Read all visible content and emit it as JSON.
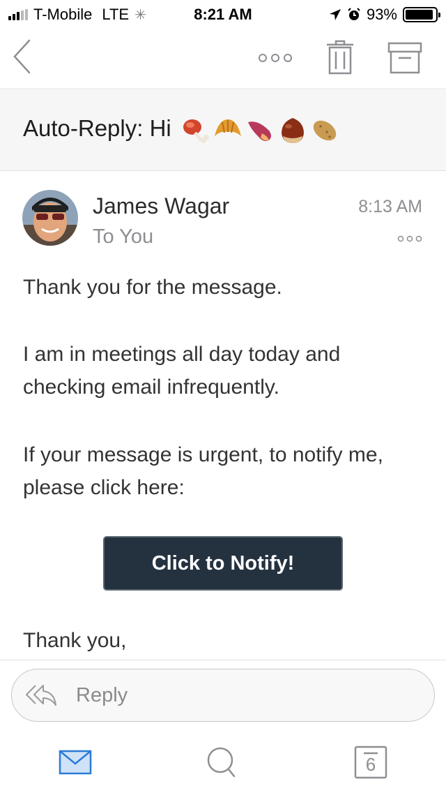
{
  "status_bar": {
    "carrier": "T-Mobile",
    "network": "LTE",
    "time": "8:21 AM",
    "battery_percent": "93%",
    "battery_level": 0.93,
    "signal_bars": 3,
    "signal_bars_total": 5
  },
  "toolbar": {
    "icons": [
      "back-chevron-icon",
      "more-icon",
      "trash-icon",
      "archive-icon"
    ]
  },
  "email": {
    "subject": "Auto-Reply: Hi",
    "subject_emoji": [
      "meat-on-bone",
      "croissant",
      "sweet-potato",
      "chestnut",
      "potato"
    ],
    "sender": "James Wagar",
    "recipient": "To You",
    "time": "8:13 AM",
    "body": {
      "p1": "Thank you for the message.",
      "p2_line1": "I am in meetings all day today and",
      "p2_line2": "checking email infrequently.",
      "p3_line1": "If your message is urgent, to notify me,",
      "p3_line2": "please click here:",
      "button_label": "Click to Notify!",
      "closing": "Thank you,"
    }
  },
  "reply": {
    "placeholder": "Reply"
  },
  "tab_bar": {
    "calendar_day": "6",
    "active_tab": "mail",
    "accent_color": "#2b7bd6"
  }
}
